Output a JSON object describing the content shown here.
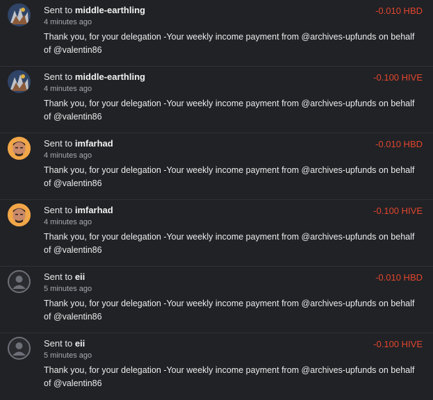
{
  "transactions": [
    {
      "prefix": "Sent to",
      "to": "middle-earthling",
      "time": "4 minutes ago",
      "amount": "-0.010 HBD",
      "memo": "Thank you, for your delegation -Your weekly income payment from @archives-upfunds on behalf of @valentin86",
      "avatar": "middle-earthling-avatar"
    },
    {
      "prefix": "Sent to",
      "to": "middle-earthling",
      "time": "4 minutes ago",
      "amount": "-0.100 HIVE",
      "memo": "Thank you, for your delegation -Your weekly income payment from @archives-upfunds on behalf of @valentin86",
      "avatar": "middle-earthling-avatar"
    },
    {
      "prefix": "Sent to",
      "to": "imfarhad",
      "time": "4 minutes ago",
      "amount": "-0.010 HBD",
      "memo": "Thank you, for your delegation -Your weekly income payment from @archives-upfunds on behalf of @valentin86",
      "avatar": "imfarhad-avatar"
    },
    {
      "prefix": "Sent to",
      "to": "imfarhad",
      "time": "4 minutes ago",
      "amount": "-0.100 HIVE",
      "memo": "Thank you, for your delegation -Your weekly income payment from @archives-upfunds on behalf of @valentin86",
      "avatar": "imfarhad-avatar"
    },
    {
      "prefix": "Sent to",
      "to": "eii",
      "time": "5 minutes ago",
      "amount": "-0.010 HBD",
      "memo": "Thank you, for your delegation -Your weekly income payment from @archives-upfunds on behalf of @valentin86",
      "avatar": "default-user-avatar"
    },
    {
      "prefix": "Sent to",
      "to": "eii",
      "time": "5 minutes ago",
      "amount": "-0.100 HIVE",
      "memo": "Thank you, for your delegation -Your weekly income payment from @archives-upfunds on behalf of @valentin86",
      "avatar": "default-user-avatar"
    }
  ],
  "colors": {
    "background": "#212226",
    "amount_negative": "#e3462d",
    "divider": "#313237"
  }
}
